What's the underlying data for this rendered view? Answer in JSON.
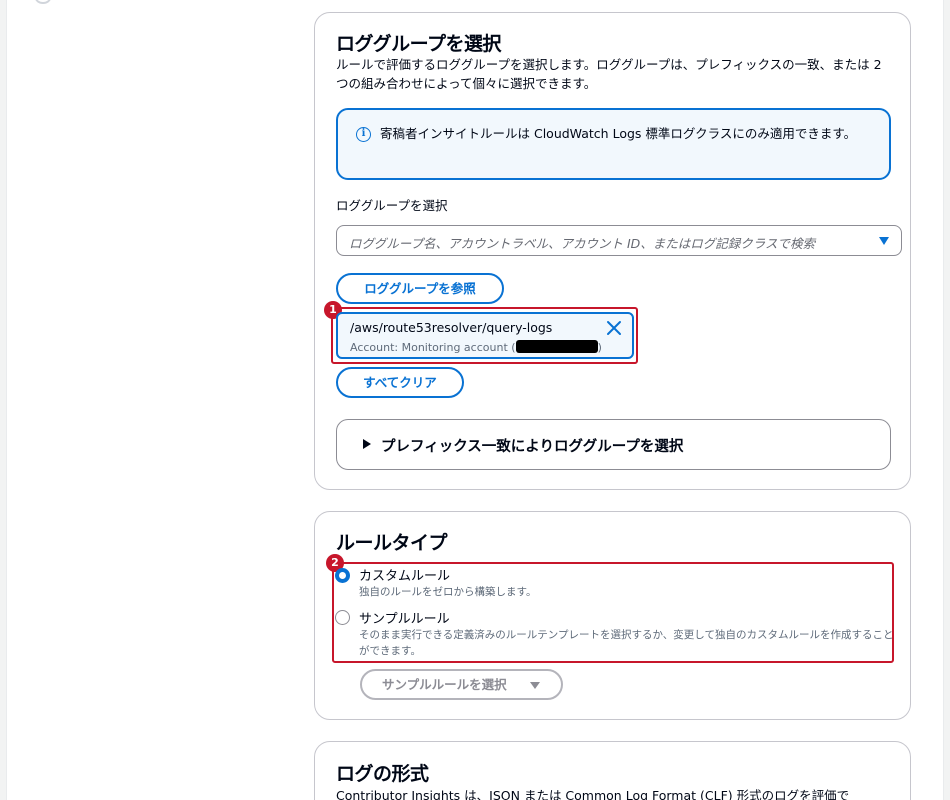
{
  "log_group_section": {
    "title": "ロググループを選択",
    "description": "ルールで評価するロググループを選択します。ロググループは、プレフィックスの一致、または 2 つの組み合わせによって個々に選択できます。",
    "info_alert": "寄稿者インサイトルールは CloudWatch Logs 標準ログクラスにのみ適用できます。",
    "field_label": "ロググループを選択",
    "select_placeholder": "ロググループ名、アカウントラベル、アカウント ID、またはログ記録クラスで検索",
    "browse_button": "ロググループを参照",
    "selected_token": {
      "name": "/aws/route53resolver/query-logs",
      "account_prefix": "Account: Monitoring account (",
      "account_suffix": ")"
    },
    "clear_all_button": "すべてクリア",
    "prefix_expander": "プレフィックス一致によりロググループを選択",
    "annotation_badge": "1"
  },
  "rule_type_section": {
    "title": "ルールタイプ",
    "annotation_badge": "2",
    "options": [
      {
        "label": "カスタムルール",
        "description": "独自のルールをゼロから構築します。",
        "selected": true
      },
      {
        "label": "サンプルルール",
        "description": "そのまま実行できる定義済みのルールテンプレートを選択するか、変更して独自のカスタムルールを作成することができます。",
        "selected": false
      }
    ],
    "sample_select_button": "サンプルルールを選択"
  },
  "log_format_section": {
    "title": "ログの形式",
    "description": "Contributor Insights は、JSON または Common Log Format (CLF) 形式のログを評価で"
  },
  "colors": {
    "accent": "#0972d3",
    "highlight": "#c7162b",
    "info_bg": "#f2f8fd"
  }
}
